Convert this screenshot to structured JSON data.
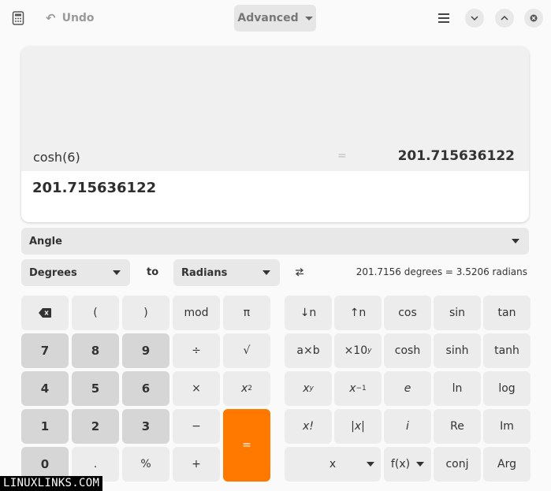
{
  "header": {
    "undo_label": "Undo",
    "mode_label": "Advanced",
    "icons": [
      "calculator-icon",
      "undo-icon",
      "chevron-down-icon",
      "hamburger-menu-icon",
      "minimize-icon",
      "maximize-icon",
      "close-icon"
    ]
  },
  "display": {
    "history_expression": "cosh(6)",
    "history_equals": "=",
    "history_result": "201.715636122",
    "entry_value": "201.715636122"
  },
  "converter": {
    "category": "Angle",
    "from_unit": "Degrees",
    "to_label": "to",
    "to_unit": "Radians",
    "result": "201.7156 degrees  =  3.5206 radians"
  },
  "keypad_basic": {
    "backspace": "⌫",
    "open_paren": "(",
    "close_paren": ")",
    "mod": "mod",
    "pi": "π",
    "k7": "7",
    "k8": "8",
    "k9": "9",
    "divide": "÷",
    "sqrt": "√",
    "k4": "4",
    "k5": "5",
    "k6": "6",
    "multiply": "×",
    "square_base": "x",
    "square_exp": "2",
    "k1": "1",
    "k2": "2",
    "k3": "3",
    "subtract": "−",
    "equals": "=",
    "k0": "0",
    "decimal": ".",
    "percent": "%",
    "add": "+"
  },
  "keypad_advanced": {
    "shift_down": "↓n",
    "shift_up": "↑n",
    "cos": "cos",
    "sin": "sin",
    "tan": "tan",
    "atimesb": "a×b",
    "times10_base": "×10",
    "times10_exp": "y",
    "cosh": "cosh",
    "sinh": "sinh",
    "tanh": "tanh",
    "power_base": "x",
    "power_exp": "y",
    "inverse_base": "x",
    "inverse_exp": "−1",
    "e": "e",
    "ln": "ln",
    "log": "log",
    "factorial": "x!",
    "abs": "|x|",
    "i": "i",
    "re": "Re",
    "im": "Im",
    "variable": "x",
    "function": "f(x)",
    "conj": "conj",
    "arg": "Arg"
  },
  "watermark": "LINUXLINKS.COM"
}
